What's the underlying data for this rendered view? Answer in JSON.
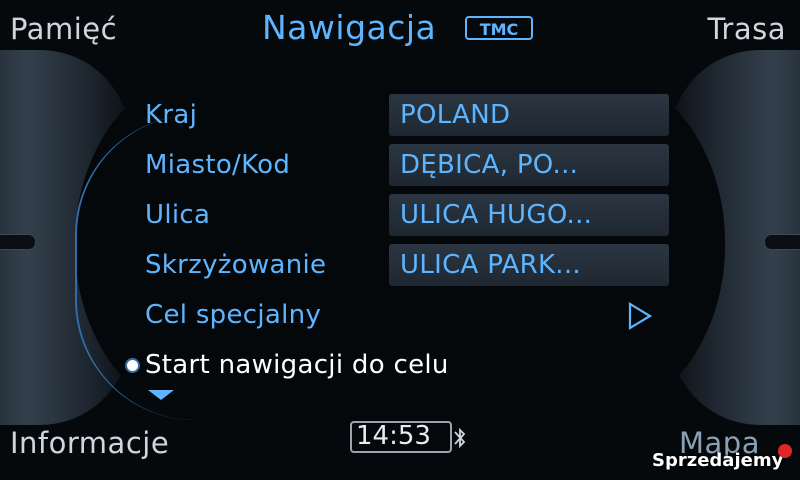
{
  "header": {
    "left": "Pamięć",
    "title": "Nawigacja",
    "badge": "TMC",
    "right": "Trasa"
  },
  "footer": {
    "left": "Informacje",
    "right": "Mapa",
    "clock": "14:53"
  },
  "rows": [
    {
      "label": "Kraj",
      "value": "POLAND"
    },
    {
      "label": "Miasto/Kod",
      "value": "DĘBICA, PO..."
    },
    {
      "label": "Ulica",
      "value": "ULICA HUGO..."
    },
    {
      "label": "Skrzyżowanie",
      "value": "ULICA PARK..."
    }
  ],
  "special": {
    "label": "Cel specjalny"
  },
  "start": {
    "label": "Start nawigacji do celu"
  },
  "watermark": "Sprzedajemy",
  "icons": {
    "play": "play-icon",
    "scroll": "chevron-down-icon",
    "bluetooth": "bluetooth-icon"
  },
  "colors": {
    "accent": "#5eb5ff",
    "text": "#cfd6dd",
    "selected": "#ffffff"
  }
}
